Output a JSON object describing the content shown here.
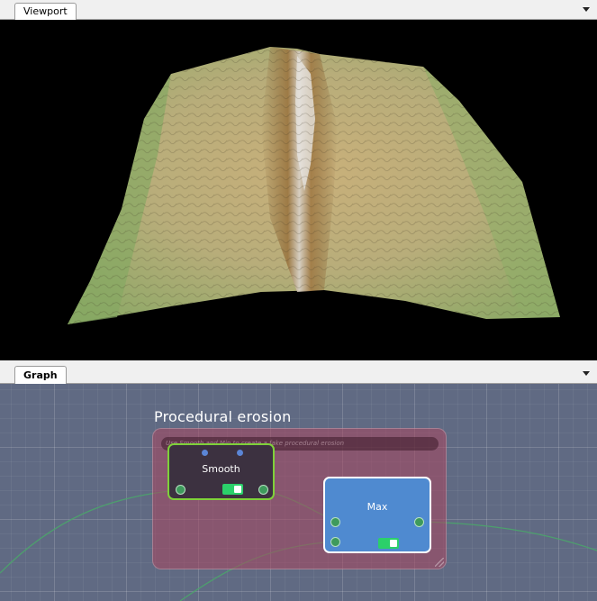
{
  "viewport_panel": {
    "tab_label": "Viewport"
  },
  "graph_panel": {
    "tab_label": "Graph",
    "group": {
      "title": "Procedural erosion",
      "comment": "Use Smooth and Min to create a fake procedural erosion"
    },
    "nodes": [
      {
        "title": "Smooth",
        "border_color": "#7fd13a",
        "fill_color": "#3c3140",
        "enabled": true,
        "selected": false
      },
      {
        "title": "Max",
        "border_color": "#ffffff",
        "fill_color": "#4f8ad0",
        "enabled": true,
        "selected": true
      }
    ]
  },
  "colors": {
    "graph_background": "#606a83",
    "group_fill": "#aa465f",
    "port_green": "#3e9a5c",
    "toggle_green": "#2bd06a",
    "wire_green": "#4aa86a"
  }
}
